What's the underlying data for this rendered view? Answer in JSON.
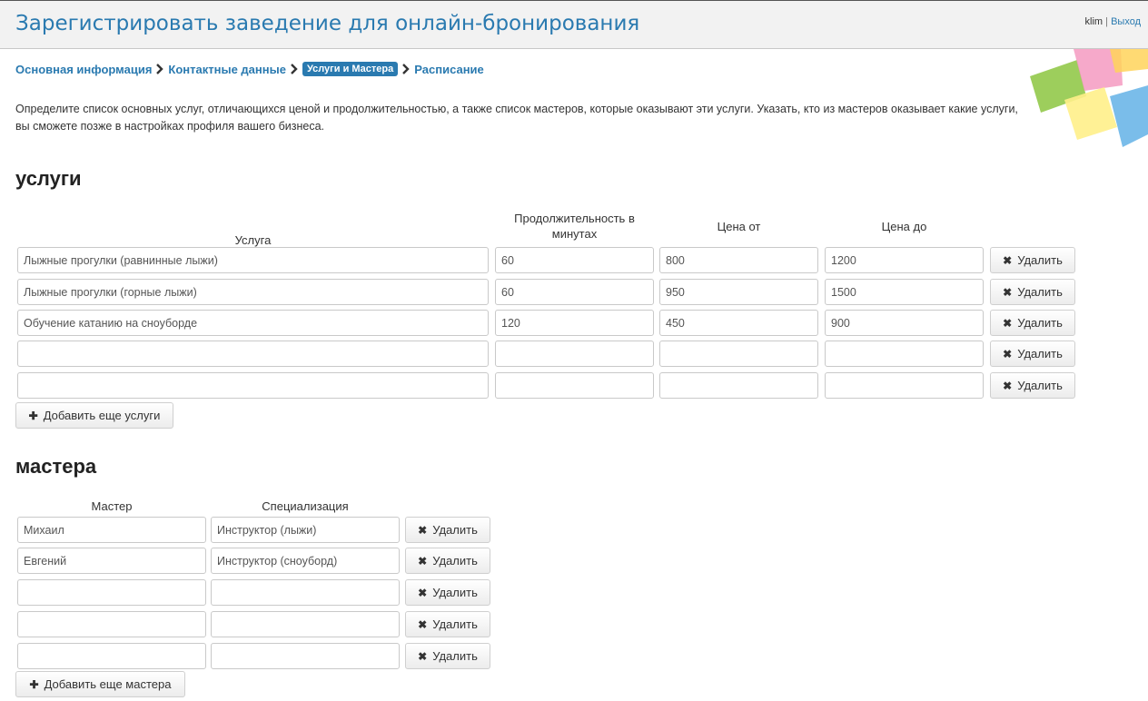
{
  "header": {
    "title": "Зарегистрировать заведение для онлайн-бронирования",
    "user": "klim",
    "separator": "|",
    "logout": "Выход"
  },
  "steps": [
    {
      "label": "Основная информация",
      "active": false
    },
    {
      "label": "Контактные данные",
      "active": false
    },
    {
      "label": "Услуги и Мастера",
      "active": true
    },
    {
      "label": "Расписание",
      "active": false
    }
  ],
  "intro": "Определите список основных услуг, отличающихся ценой и продолжительностью, а также список мастеров, которые оказывают эти услуги. Указать, кто из мастеров оказывает какие услуги, вы сможете позже в настройках профиля вашего бизнеса.",
  "services": {
    "title": "услуги",
    "columns": {
      "service": "Услуга",
      "duration": "Продолжительность в минутах",
      "price_from": "Цена от",
      "price_to": "Цена до"
    },
    "rows": [
      {
        "service": "Лыжные прогулки (равнинные лыжи)",
        "duration": "60",
        "price_from": "800",
        "price_to": "1200"
      },
      {
        "service": "Лыжные прогулки (горные лыжи)",
        "duration": "60",
        "price_from": "950",
        "price_to": "1500"
      },
      {
        "service": "Обучение катанию на сноуборде",
        "duration": "120",
        "price_from": "450",
        "price_to": "900"
      },
      {
        "service": "",
        "duration": "",
        "price_from": "",
        "price_to": ""
      },
      {
        "service": "",
        "duration": "",
        "price_from": "",
        "price_to": ""
      }
    ],
    "delete_label": "Удалить",
    "add_label": "Добавить еще услуги"
  },
  "masters": {
    "title": "мастера",
    "columns": {
      "name": "Мастер",
      "specialization": "Специализация"
    },
    "rows": [
      {
        "name": "Михаил",
        "specialization": "Инструктор (лыжи)"
      },
      {
        "name": "Евгений",
        "specialization": "Инструктор (сноуборд)"
      },
      {
        "name": "",
        "specialization": ""
      },
      {
        "name": "",
        "specialization": ""
      },
      {
        "name": "",
        "specialization": ""
      }
    ],
    "delete_label": "Удалить",
    "add_label": "Добавить еще мастера"
  },
  "colors": {
    "accent": "#2a7ab0",
    "topbar": "#f2f2f2"
  },
  "icons": {
    "delete": "close-icon",
    "add": "plus-icon",
    "step_separator": "chevron-right-icon"
  }
}
